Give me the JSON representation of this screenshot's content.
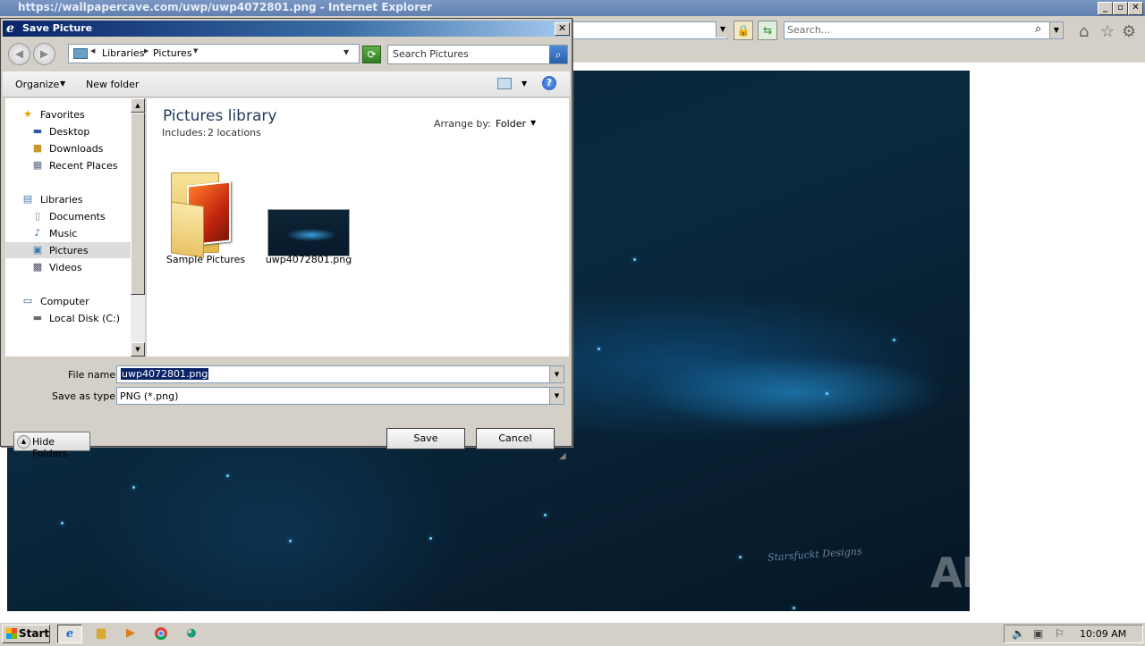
{
  "browser": {
    "title": "https://wallpapercave.com/uwp/uwp4072801.png - Internet Explorer",
    "search_placeholder": "Search...",
    "icons": {
      "home": "home-icon",
      "favorites": "star-icon",
      "tools": "gear-icon"
    }
  },
  "image": {
    "signature": "Starsfuckt Designs",
    "watermark": "ANY RUN"
  },
  "dialog": {
    "title": "Save Picture",
    "breadcrumb": [
      "Libraries",
      "Pictures"
    ],
    "search_placeholder": "Search Pictures",
    "toolbar": {
      "organize": "Organize",
      "new_folder": "New folder"
    },
    "nav": {
      "favorites": {
        "label": "Favorites",
        "items": [
          "Desktop",
          "Downloads",
          "Recent Places"
        ]
      },
      "libraries": {
        "label": "Libraries",
        "items": [
          "Documents",
          "Music",
          "Pictures",
          "Videos"
        ]
      },
      "computer": {
        "label": "Computer",
        "items": [
          "Local Disk (C:)"
        ]
      },
      "selected": "Pictures"
    },
    "library": {
      "title": "Pictures library",
      "includes_label": "Includes:",
      "includes_value": "2 locations",
      "arrange_by_label": "Arrange by:",
      "arrange_by_value": "Folder"
    },
    "items": [
      {
        "name": "Sample Pictures",
        "type": "folder"
      },
      {
        "name": "uwp4072801.png",
        "type": "image"
      }
    ],
    "form": {
      "file_name_label": "File name:",
      "file_name_value": "uwp4072801.png",
      "save_as_type_label": "Save as type:",
      "save_as_type_value": "PNG (*.png)"
    },
    "buttons": {
      "hide_folders": "Hide Folders",
      "save": "Save",
      "cancel": "Cancel"
    }
  },
  "taskbar": {
    "start": "Start",
    "clock": "10:09 AM"
  }
}
